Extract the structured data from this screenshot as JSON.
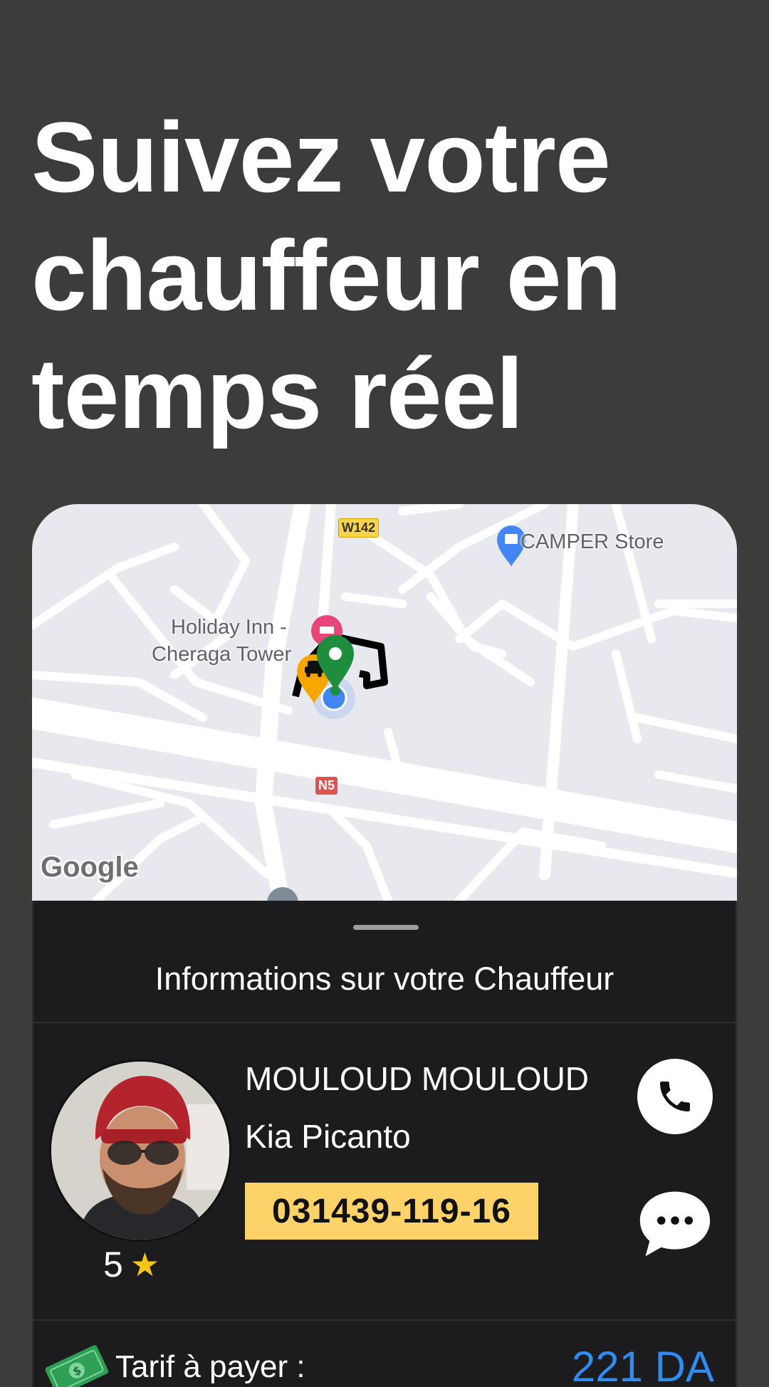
{
  "headline": {
    "line1": "Suivez votre",
    "line2": "chauffeur en",
    "line3": "temps réel"
  },
  "map": {
    "labels": {
      "store": "CAMPER Store",
      "hotel_line1": "Holiday Inn -",
      "hotel_line2": "Cheraga Tower",
      "road_w142": "W142",
      "road_n5": "N5",
      "attribution": "Google"
    }
  },
  "sheet": {
    "title": "Informations sur votre Chauffeur",
    "driver": {
      "name": "MOULOUD MOULOUD",
      "car": "Kia Picanto",
      "plate": "031439-119-16",
      "rating": "5"
    },
    "fare": {
      "label": "Tarif à payer :",
      "value": "221 DA"
    }
  },
  "icons": {
    "call": "phone-icon",
    "message": "chat-bubble-icon",
    "rating": "star-icon",
    "fare": "money-icon"
  },
  "colors": {
    "background": "#3d3c3b",
    "sheet": "#1c1c1e",
    "plate": "#fdd369",
    "fare_value": "#2f8cf3",
    "star": "#f5c518"
  }
}
